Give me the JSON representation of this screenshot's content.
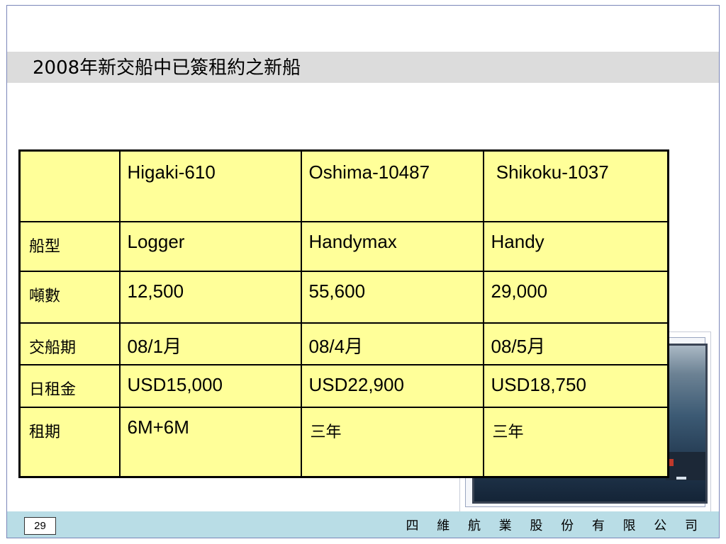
{
  "slide": {
    "title": "2008年新交船中已簽租約之新船",
    "page_number": "29",
    "company": "四 維 航 業 股 份 有 限 公 司"
  },
  "table": {
    "header": [
      "",
      "Higaki-610",
      "Oshima-10487",
      " Shikoku-1037"
    ],
    "rows": [
      [
        "船型",
        "Logger",
        "Handymax",
        "Handy"
      ],
      [
        "噸數",
        "12,500",
        "55,600",
        "29,000"
      ],
      [
        "交船期",
        "08/1月",
        "08/4月",
        "08/5月"
      ],
      [
        "日租金",
        "USD15,000",
        "USD22,900",
        "USD18,750"
      ],
      [
        "租期",
        "6M+6M",
        "三年",
        "三年"
      ]
    ]
  },
  "colors": {
    "table_fill": "#ffff99",
    "title_band": "#dcdcdc",
    "footer_band": "#b9dde6"
  }
}
